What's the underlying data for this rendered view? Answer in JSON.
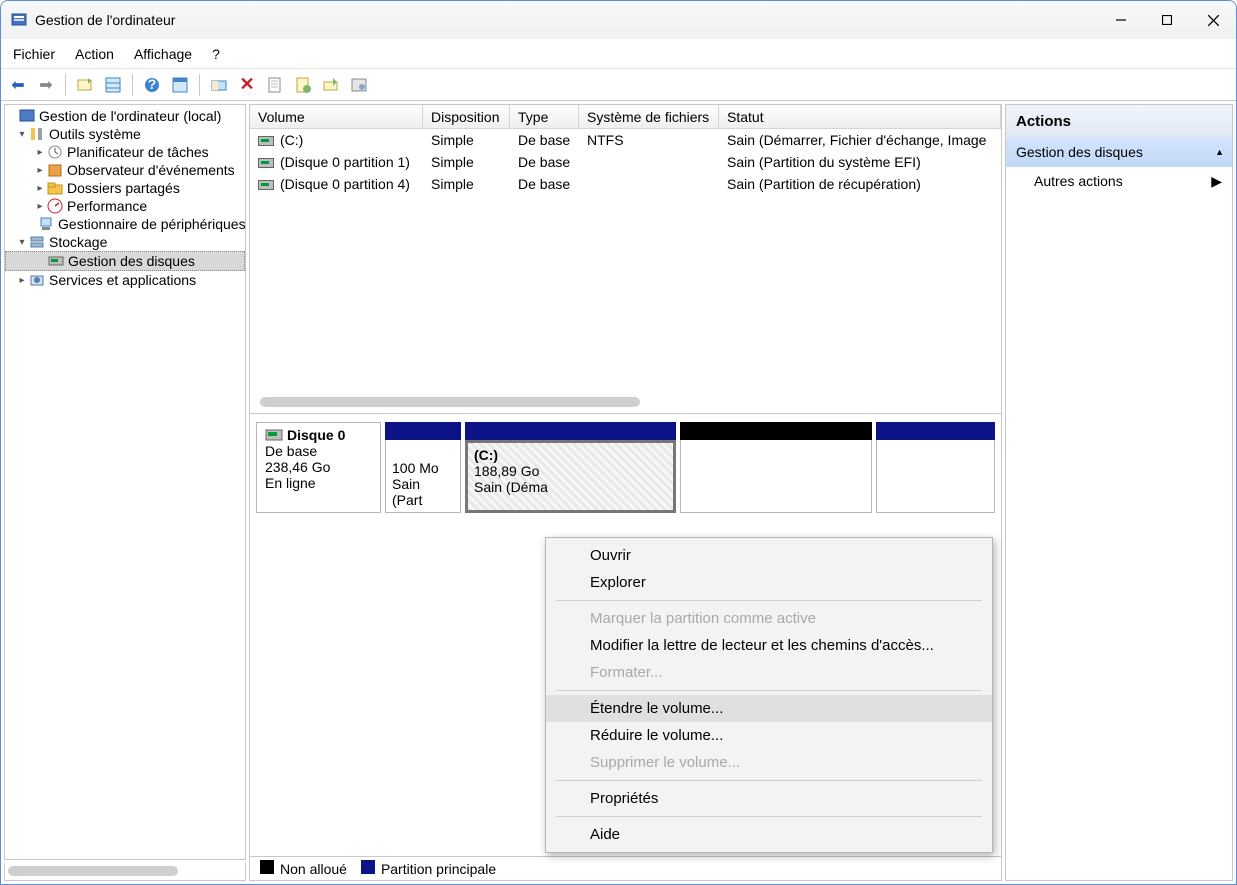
{
  "window": {
    "title": "Gestion de l'ordinateur"
  },
  "menu": {
    "file": "Fichier",
    "action": "Action",
    "view": "Affichage",
    "help": "?"
  },
  "tree": {
    "root": "Gestion de l'ordinateur (local)",
    "tools": "Outils système",
    "sched": "Planificateur de tâches",
    "events": "Observateur d'événements",
    "shared": "Dossiers partagés",
    "perf": "Performance",
    "devmgr": "Gestionnaire de périphériques",
    "storage": "Stockage",
    "disks": "Gestion des disques",
    "services": "Services et applications"
  },
  "table": {
    "cols": {
      "volume": "Volume",
      "layout": "Disposition",
      "type": "Type",
      "fs": "Système de fichiers",
      "status": "Statut"
    },
    "rows": [
      {
        "name": "(C:)",
        "layout": "Simple",
        "type": "De base",
        "fs": "NTFS",
        "status": "Sain (Démarrer, Fichier d'échange, Image"
      },
      {
        "name": "(Disque 0 partition 1)",
        "layout": "Simple",
        "type": "De base",
        "fs": "",
        "status": "Sain (Partition du système EFI)"
      },
      {
        "name": "(Disque 0 partition 4)",
        "layout": "Simple",
        "type": "De base",
        "fs": "",
        "status": "Sain (Partition de récupération)"
      }
    ]
  },
  "disk": {
    "name": "Disque 0",
    "type": "De base",
    "size": "238,46 Go",
    "state": "En ligne",
    "p1": {
      "size": "100 Mo",
      "status": "Sain (Part"
    },
    "p2": {
      "name": "(C:)",
      "size": "188,89 Go",
      "status": "Sain (Déma"
    }
  },
  "legend": {
    "unalloc": "Non alloué",
    "primary": "Partition principale"
  },
  "actions": {
    "title": "Actions",
    "section": "Gestion des disques",
    "more": "Autres actions"
  },
  "ctx": {
    "open": "Ouvrir",
    "explore": "Explorer",
    "markactive": "Marquer la partition comme active",
    "modify": "Modifier la lettre de lecteur et les chemins d'accès...",
    "format": "Formater...",
    "extend": "Étendre le volume...",
    "shrink": "Réduire le volume...",
    "delete": "Supprimer le volume...",
    "props": "Propriétés",
    "help": "Aide"
  }
}
